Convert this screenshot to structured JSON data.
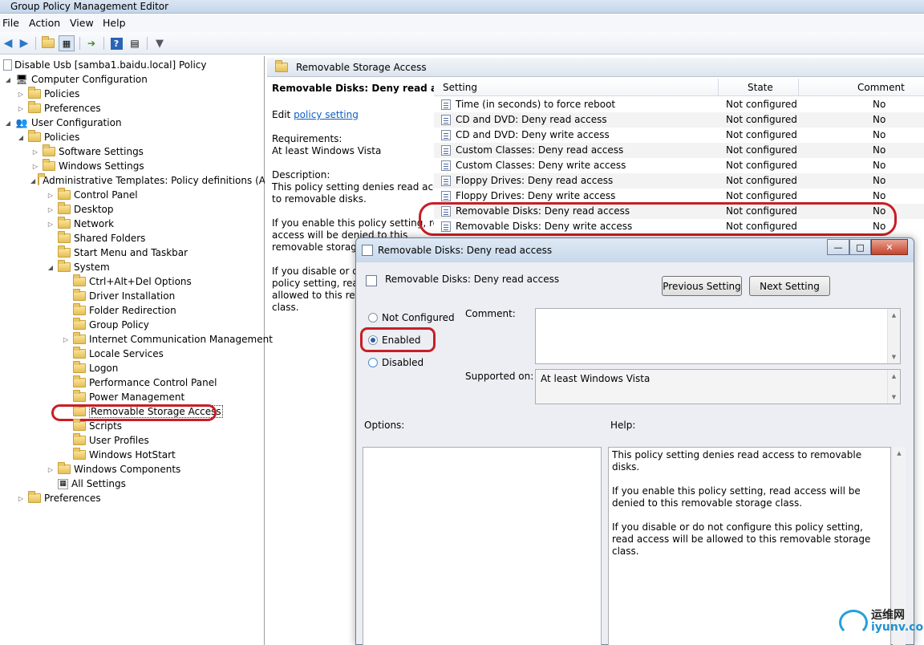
{
  "window": {
    "title": "Group Policy Management Editor"
  },
  "menu": [
    "File",
    "Action",
    "View",
    "Help"
  ],
  "tree": {
    "root": "Disable Usb  [samba1.baidu.local] Policy",
    "items": [
      "Computer Configuration",
      "Policies",
      "Preferences",
      "User Configuration",
      "Policies",
      "Software Settings",
      "Windows Settings",
      "Administrative Templates: Policy definitions (AD",
      "Control Panel",
      "Desktop",
      "Network",
      "Shared Folders",
      "Start Menu and Taskbar",
      "System",
      "Ctrl+Alt+Del Options",
      "Driver Installation",
      "Folder Redirection",
      "Group Policy",
      "Internet Communication Management",
      "Locale Services",
      "Logon",
      "Performance Control Panel",
      "Power Management",
      "Removable Storage Access",
      "Scripts",
      "User Profiles",
      "Windows HotStart",
      "Windows Components",
      "All Settings",
      "Preferences"
    ]
  },
  "middle": {
    "header": "Removable Storage Access",
    "policy_title": "Removable Disks: Deny read access",
    "edit_prefix": "Edit ",
    "edit_link": "policy setting",
    "requirements_label": "Requirements:",
    "requirements_value": "At least Windows Vista",
    "description_label": "Description:",
    "description_lines": [
      "This policy setting denies read access",
      "to removable disks."
    ],
    "enable_lines": [
      "If you enable this policy setting, read",
      "access will be denied to this",
      "removable storage"
    ],
    "disable_lines": [
      "If you disable or do",
      "policy setting, read",
      "allowed to this rem",
      "class."
    ]
  },
  "list": {
    "columns": {
      "setting": "Setting",
      "state": "State",
      "comment": "Comment"
    },
    "rows": [
      {
        "setting": "Time (in seconds) to force reboot",
        "state": "Not configured",
        "comment": "No"
      },
      {
        "setting": "CD and DVD: Deny read access",
        "state": "Not configured",
        "comment": "No"
      },
      {
        "setting": "CD and DVD: Deny write access",
        "state": "Not configured",
        "comment": "No"
      },
      {
        "setting": "Custom Classes: Deny read access",
        "state": "Not configured",
        "comment": "No"
      },
      {
        "setting": "Custom Classes: Deny write access",
        "state": "Not configured",
        "comment": "No"
      },
      {
        "setting": "Floppy Drives: Deny read access",
        "state": "Not configured",
        "comment": "No"
      },
      {
        "setting": "Floppy Drives: Deny write access",
        "state": "Not configured",
        "comment": "No"
      },
      {
        "setting": "Removable Disks: Deny read access",
        "state": "Not configured",
        "comment": "No"
      },
      {
        "setting": "Removable Disks: Deny write access",
        "state": "Not configured",
        "comment": "No"
      }
    ]
  },
  "dialog": {
    "title": "Removable Disks: Deny read access",
    "heading": "Removable Disks: Deny read access",
    "prev_button": "Previous Setting",
    "next_button": "Next Setting",
    "radio_not_configured": "Not Configured",
    "radio_enabled": "Enabled",
    "radio_disabled": "Disabled",
    "selected": "Enabled",
    "comment_label": "Comment:",
    "supported_label": "Supported on:",
    "supported_value": "At least Windows Vista",
    "options_label": "Options:",
    "help_label": "Help:",
    "help_p1": "This policy setting denies read access to removable disks.",
    "help_p2": "If you enable this policy setting, read access will be denied to this removable storage class.",
    "help_p3": "If you disable or do not configure this policy setting, read access will be allowed to this removable storage class."
  },
  "watermark": {
    "cn": "运维网",
    "en": "iyunv.com"
  },
  "colors": {
    "highlight_ring": "#c81e25",
    "link": "#0f5fc4"
  }
}
